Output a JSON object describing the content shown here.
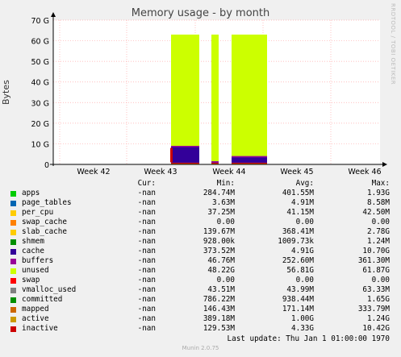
{
  "chart_data": {
    "type": "area",
    "title": "Memory usage - by month",
    "ylabel": "Bytes",
    "side_label": "RRDTOOL / TOBI OETIKER",
    "ylim": [
      0,
      70
    ],
    "yticks": [
      "0",
      "10 G",
      "20 G",
      "30 G",
      "40 G",
      "50 G",
      "60 G",
      "70 G"
    ],
    "xticks": [
      "Week 42",
      "Week 43",
      "Week 44",
      "Week 45",
      "Week 46"
    ],
    "grid": true,
    "series_colors": {
      "unused": "#ccff00",
      "cache": "#330099",
      "buffers": "#990099",
      "apps": "#00cc00",
      "inactive": "#cc0000",
      "mapped": "#cc6600"
    },
    "stack_segments": [
      {
        "series": "unused",
        "data": [
          [
            43.25,
            0,
            63
          ],
          [
            44.05,
            63
          ],
          [
            43.6,
            0
          ]
        ]
      },
      {
        "series": "cache",
        "data": [
          [
            43.25,
            0,
            9
          ],
          [
            43.6,
            9
          ]
        ]
      }
    ],
    "legend_headers": {
      "cur": "Cur:",
      "min": "Min:",
      "avg": "Avg:",
      "max": "Max:"
    },
    "legend": [
      {
        "name": "apps",
        "color": "#00cc00",
        "cur": "-nan",
        "min": "284.74M",
        "avg": "401.55M",
        "max": "1.93G"
      },
      {
        "name": "page_tables",
        "color": "#0066b3",
        "cur": "-nan",
        "min": "3.63M",
        "avg": "4.91M",
        "max": "8.58M"
      },
      {
        "name": "per_cpu",
        "color": "#ffcc00",
        "cur": "-nan",
        "min": "37.25M",
        "avg": "41.15M",
        "max": "42.50M"
      },
      {
        "name": "swap_cache",
        "color": "#ff8000",
        "cur": "-nan",
        "min": "0.00",
        "avg": "0.00",
        "max": "0.00"
      },
      {
        "name": "slab_cache",
        "color": "#ffcc00",
        "cur": "-nan",
        "min": "139.67M",
        "avg": "368.41M",
        "max": "2.78G"
      },
      {
        "name": "shmem",
        "color": "#008f00",
        "cur": "-nan",
        "min": "928.00k",
        "avg": "1009.73k",
        "max": "1.24M"
      },
      {
        "name": "cache",
        "color": "#330099",
        "cur": "-nan",
        "min": "373.52M",
        "avg": "4.91G",
        "max": "10.70G"
      },
      {
        "name": "buffers",
        "color": "#990099",
        "cur": "-nan",
        "min": "46.76M",
        "avg": "252.60M",
        "max": "361.30M"
      },
      {
        "name": "unused",
        "color": "#ccff00",
        "cur": "-nan",
        "min": "48.22G",
        "avg": "56.81G",
        "max": "61.87G"
      },
      {
        "name": "swap",
        "color": "#ff0000",
        "cur": "-nan",
        "min": "0.00",
        "avg": "0.00",
        "max": "0.00"
      },
      {
        "name": "vmalloc_used",
        "color": "#808080",
        "cur": "-nan",
        "min": "43.51M",
        "avg": "43.99M",
        "max": "63.33M"
      },
      {
        "name": "committed",
        "color": "#008f00",
        "cur": "-nan",
        "min": "786.22M",
        "avg": "938.44M",
        "max": "1.65G"
      },
      {
        "name": "mapped",
        "color": "#cc6600",
        "cur": "-nan",
        "min": "146.43M",
        "avg": "171.14M",
        "max": "333.79M"
      },
      {
        "name": "active",
        "color": "#cc9900",
        "cur": "-nan",
        "min": "389.18M",
        "avg": "1.00G",
        "max": "1.24G"
      },
      {
        "name": "inactive",
        "color": "#cc0000",
        "cur": "-nan",
        "min": "129.53M",
        "avg": "4.33G",
        "max": "10.42G"
      }
    ],
    "last_update": "Last update: Thu Jan  1 01:00:00 1970",
    "footer": "Munin 2.0.75"
  }
}
